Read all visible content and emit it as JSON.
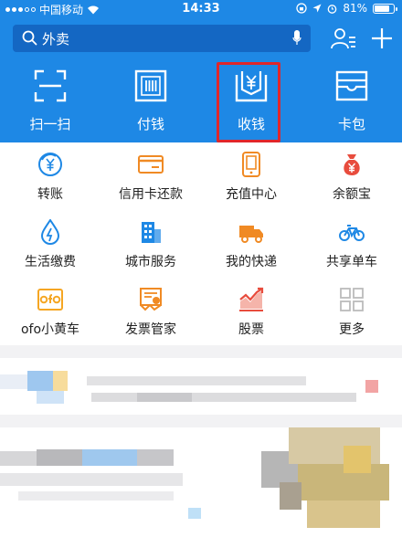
{
  "status_bar": {
    "carrier": "中国移动",
    "time": "14:33",
    "battery": "81%",
    "battery_level": 0.81
  },
  "search": {
    "placeholder": "外卖"
  },
  "header_icons": [
    "contacts-icon",
    "plus-icon",
    "search-icon",
    "microphone-icon"
  ],
  "quick_actions": [
    {
      "label": "扫一扫",
      "icon": "scan-icon"
    },
    {
      "label": "付钱",
      "icon": "barcode-icon"
    },
    {
      "label": "收钱",
      "icon": "yuan-receipt-icon"
    },
    {
      "label": "卡包",
      "icon": "card-wallet-icon"
    }
  ],
  "highlighted_action": "收钱",
  "services": [
    {
      "label": "转账",
      "icon": "transfer-icon"
    },
    {
      "label": "信用卡还款",
      "icon": "credit-card-icon"
    },
    {
      "label": "充值中心",
      "icon": "phone-recharge-icon"
    },
    {
      "label": "余额宝",
      "icon": "money-bag-icon"
    },
    {
      "label": "生活缴费",
      "icon": "water-drop-icon"
    },
    {
      "label": "城市服务",
      "icon": "city-building-icon"
    },
    {
      "label": "我的快递",
      "icon": "delivery-truck-icon"
    },
    {
      "label": "共享单车",
      "icon": "bicycle-icon"
    },
    {
      "label": "ofo小黄车",
      "icon": "ofo-icon"
    },
    {
      "label": "发票管家",
      "icon": "invoice-icon"
    },
    {
      "label": "股票",
      "icon": "stock-chart-icon"
    },
    {
      "label": "更多",
      "icon": "more-grid-icon"
    }
  ],
  "colors": {
    "header_blue": "#1e88e5",
    "search_bg": "#1467c3",
    "highlight_red": "#e0262a",
    "ofo_yellow": "#f5a623",
    "stock_red": "#e84c3d"
  }
}
